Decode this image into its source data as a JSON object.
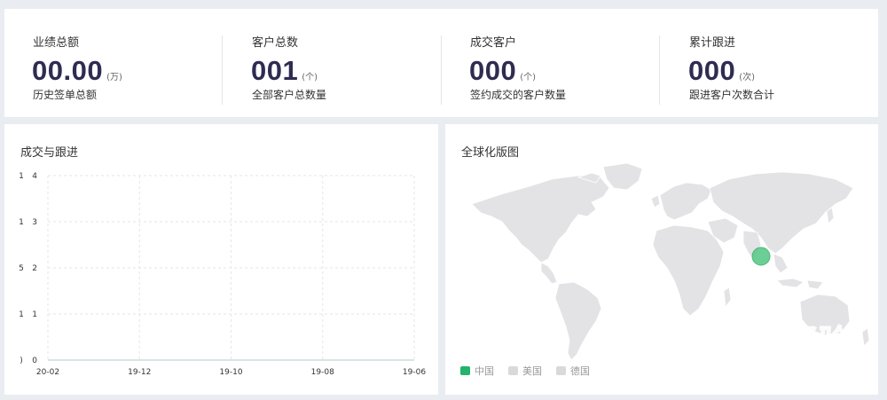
{
  "stats": [
    {
      "label": "业绩总额",
      "value": "00.00",
      "unit": "(万)",
      "desc": "历史签单总额"
    },
    {
      "label": "客户总数",
      "value": "001",
      "unit": "(个)",
      "desc": "全部客户总数量"
    },
    {
      "label": "成交客户",
      "value": "000",
      "unit": "(个)",
      "desc": "签约成交的客户数量"
    },
    {
      "label": "累计跟进",
      "value": "000",
      "unit": "(次)",
      "desc": "跟进客户次数合计"
    }
  ],
  "deal_chart": {
    "title": "成交与跟进",
    "left_marks": [
      "1",
      "1",
      "5",
      "1",
      ")"
    ],
    "y_ticks": [
      "4",
      "3",
      "2",
      "1",
      "0"
    ],
    "x_ticks": [
      "20-02",
      "19-12",
      "19-10",
      "19-08",
      "19-06"
    ]
  },
  "chart_data": {
    "type": "line",
    "categories": [
      "20-02",
      "19-12",
      "19-10",
      "19-08",
      "19-06"
    ],
    "series": [
      {
        "values": [
          0,
          0,
          0,
          0,
          0
        ]
      }
    ],
    "ylim": [
      0,
      4
    ],
    "grid": true
  },
  "map": {
    "title": "全球化版图",
    "bubble_country": "中国",
    "bubble_color": "#5cc98a",
    "land_color": "#e3e3e6",
    "legend": [
      {
        "name": "中国",
        "color": "#23b36b"
      },
      {
        "name": "美国",
        "color": "#d9d9d9"
      },
      {
        "name": "德国",
        "color": "#d9d9d9"
      }
    ]
  },
  "watermark": {
    "logo_text": "Baidu经验",
    "url": "jingyan.baidu.com"
  },
  "colors": {
    "accent_dark": "#2f2c52",
    "line": "#7fd0c8"
  }
}
